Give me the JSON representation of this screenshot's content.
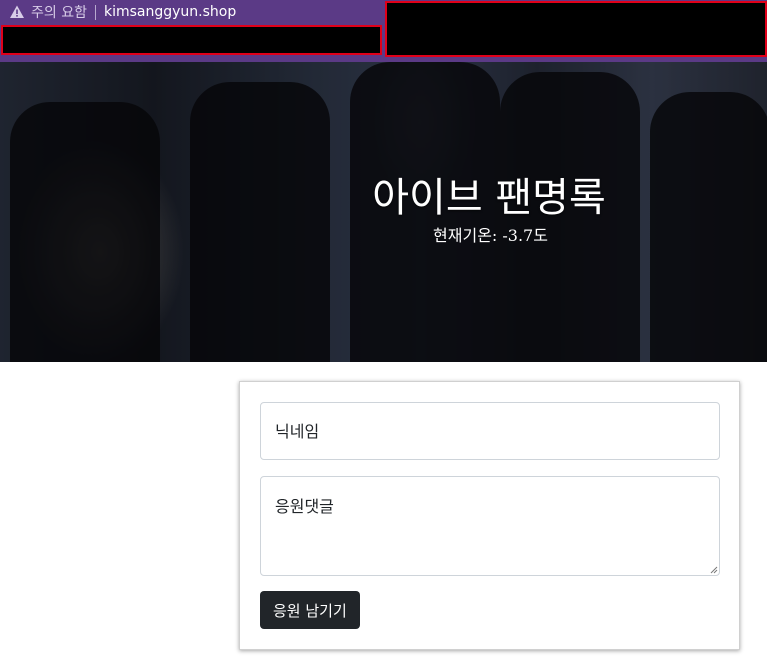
{
  "browser": {
    "warning_label": "주의 요함",
    "url": "kimsanggyun.shop"
  },
  "hero": {
    "title": "아이브 팬명록",
    "temperature": "현재기온: -3.7도"
  },
  "form": {
    "nickname_placeholder": "닉네임",
    "comment_placeholder": "응원댓글",
    "submit_label": "응원 남기기"
  }
}
